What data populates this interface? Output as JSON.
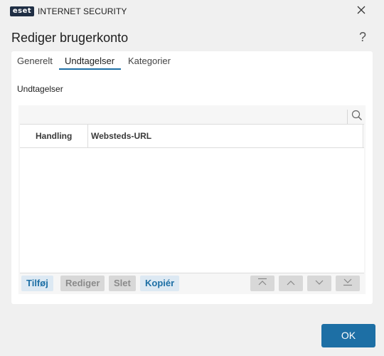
{
  "window": {
    "logo_text": "eset",
    "product_name": "INTERNET SECURITY",
    "dialog_title": "Rediger brugerkonto",
    "help_symbol": "?"
  },
  "tabs": [
    {
      "label": "Generelt",
      "active": false
    },
    {
      "label": "Undtagelser",
      "active": true
    },
    {
      "label": "Kategorier",
      "active": false
    }
  ],
  "section": {
    "label": "Undtagelser"
  },
  "search": {
    "value": "",
    "placeholder": ""
  },
  "table": {
    "columns": [
      "Handling",
      "Websteds-URL"
    ],
    "rows": []
  },
  "toolbar": {
    "add_label": "Tilføj",
    "edit_label": "Rediger",
    "delete_label": "Slet",
    "copy_label": "Kopiér"
  },
  "footer": {
    "ok_label": "OK"
  },
  "colors": {
    "accent": "#1d6fa5",
    "accent_light": "#dde9f3",
    "disabled": "#d8d8d8",
    "background": "#f0f0f0"
  },
  "icons": {
    "close": "close-icon",
    "search": "search-icon",
    "move_top": "move-top-icon",
    "move_up": "move-up-icon",
    "move_down": "move-down-icon",
    "move_bottom": "move-bottom-icon"
  }
}
